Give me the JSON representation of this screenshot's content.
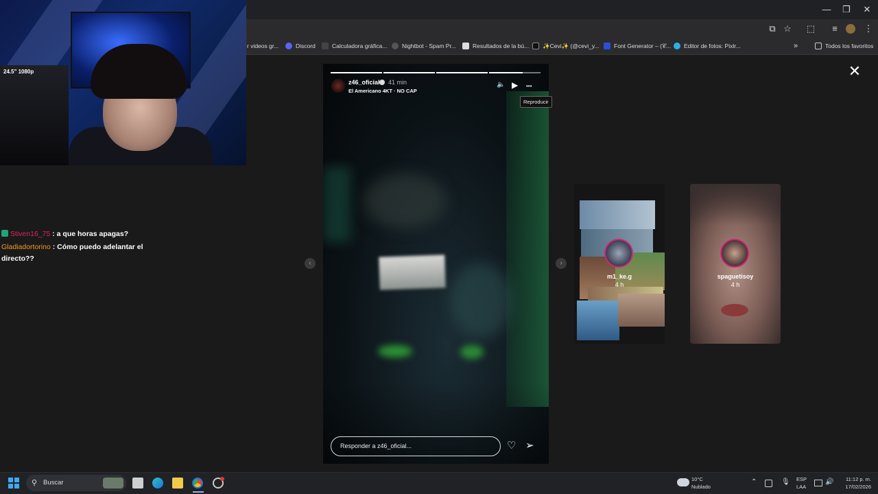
{
  "window": {
    "minimize": "—",
    "maximize": "❐",
    "close": "✕"
  },
  "toolbar": {
    "cast": "⧉",
    "star": "☆",
    "extensions": "⬚",
    "media": "≡",
    "menu": "⋮"
  },
  "bookmarks": {
    "items": [
      {
        "label": "r videos gr..."
      },
      {
        "label": "Discord"
      },
      {
        "label": "Calculadora gráfica..."
      },
      {
        "label": "Nightbot - Spam Pr..."
      },
      {
        "label": "Resultados de la bú..."
      },
      {
        "label": "✨Cevi✨ (@cevi_y..."
      },
      {
        "label": "Font Generator – (𝒞..."
      },
      {
        "label": "Editor de fotos: Pixlr..."
      }
    ],
    "overflow": "»",
    "all_label": "Todos los favoritos"
  },
  "webcam": {
    "monitor_text": "24.5\" 1080p"
  },
  "chat": [
    {
      "user": "Stiven16_75",
      "user_color": "#e0245e",
      "message": " : a que horas apagas?"
    },
    {
      "user": "Gladiadortorino",
      "user_color": "#f59a23",
      "message": " : Cómo puedo adelantar el directo??"
    }
  ],
  "story": {
    "username": "z46_oficial",
    "time_ago": "41 min",
    "song": "El Americano 4KT · NO CAP",
    "play_tooltip": "Reproducir",
    "reply_placeholder": "Responder a z46_oficial...",
    "segments": [
      1,
      1,
      1,
      0.65
    ],
    "controls": {
      "mute": "🔈",
      "play": "▶",
      "more": "•••"
    },
    "like_icon": "♡",
    "send_icon": "➢"
  },
  "nav": {
    "prev": "‹",
    "next": "›",
    "close": "✕"
  },
  "side_stories": [
    {
      "name": "m1_ke.g",
      "ago": "4 h"
    },
    {
      "name": "spaguetisoy",
      "ago": "4 h"
    }
  ],
  "taskbar": {
    "search_label": "Buscar",
    "weather_temp": "10°C",
    "weather_desc": "Nublado",
    "lang": "ESP",
    "region": "LAA",
    "time": "11:12 p. m.",
    "date": "17/02/2026"
  }
}
